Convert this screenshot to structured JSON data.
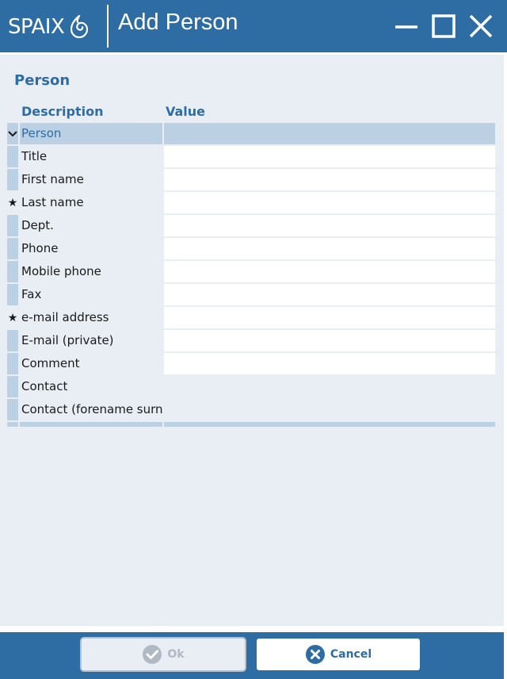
{
  "window": {
    "logo_text": "SPAIX",
    "title": "Add Person"
  },
  "form": {
    "section_title": "Person",
    "columns": {
      "description": "Description",
      "value": "Value"
    },
    "group_label": "Person",
    "rows": [
      {
        "label": "Title",
        "required": false,
        "value": ""
      },
      {
        "label": "First name",
        "required": false,
        "value": ""
      },
      {
        "label": "Last name",
        "required": true,
        "value": ""
      },
      {
        "label": "Dept.",
        "required": false,
        "value": ""
      },
      {
        "label": "Phone",
        "required": false,
        "value": ""
      },
      {
        "label": "Mobile phone",
        "required": false,
        "value": ""
      },
      {
        "label": "Fax",
        "required": false,
        "value": ""
      },
      {
        "label": "e-mail address",
        "required": true,
        "value": ""
      },
      {
        "label": "E-mail (private)",
        "required": false,
        "value": ""
      },
      {
        "label": "Comment",
        "required": false,
        "value": ""
      },
      {
        "label": "Contact",
        "required": false,
        "value": ""
      },
      {
        "label": "Contact (forename surna",
        "required": false,
        "value": ""
      }
    ]
  },
  "footer": {
    "ok_label": "Ok",
    "cancel_label": "Cancel"
  },
  "colors": {
    "brand": "#2e6da4",
    "panel": "#e9eef5",
    "row_marker": "#bcd0e4"
  }
}
